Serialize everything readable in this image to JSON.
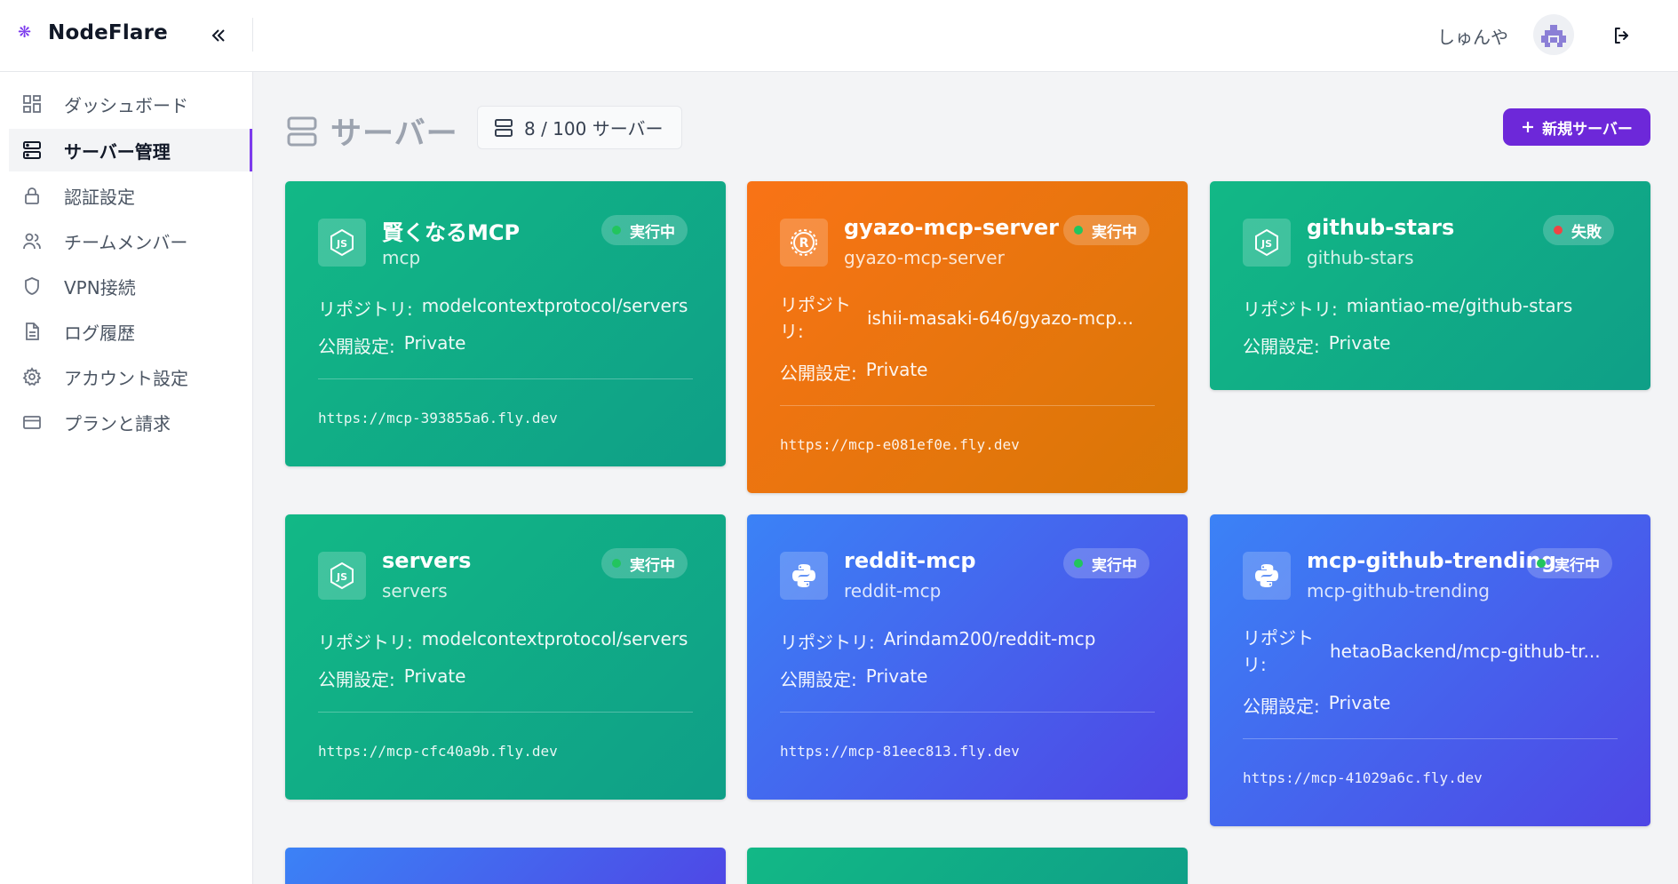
{
  "header": {
    "brand_name": "NodeFlare",
    "user_name": "しゅんや"
  },
  "sidebar": {
    "items": [
      {
        "label": "ダッシュボード",
        "icon": "dashboard-grid-icon"
      },
      {
        "label": "サーバー管理",
        "icon": "server-icon",
        "active": true
      },
      {
        "label": "認証設定",
        "icon": "lock-icon"
      },
      {
        "label": "チームメンバー",
        "icon": "users-icon"
      },
      {
        "label": "VPN接続",
        "icon": "shield-icon"
      },
      {
        "label": "ログ履歴",
        "icon": "document-icon"
      },
      {
        "label": "アカウント設定",
        "icon": "gear-icon"
      },
      {
        "label": "プランと請求",
        "icon": "credit-card-icon"
      }
    ]
  },
  "main": {
    "title": "サーバー",
    "count_label": "8 / 100 サーバー",
    "new_button_label": "新規サーバー"
  },
  "labels": {
    "repository": "リポジトリ:",
    "visibility": "公開設定:"
  },
  "cards": [
    {
      "name": "賢くなるMCP",
      "sub": "mcp",
      "status": "実行中",
      "repo": "modelcontextprotocol/servers",
      "visibility": "Private",
      "url": "https://mcp-393855a6.fly.dev",
      "theme": "green",
      "runtime": "nodejs-icon"
    },
    {
      "name": "gyazo-mcp-server",
      "sub": "gyazo-mcp-server",
      "status": "実行中",
      "repo": "ishii-masaki-646/gyazo-mcp...",
      "visibility": "Private",
      "url": "https://mcp-e081ef0e.fly.dev",
      "theme": "orange",
      "runtime": "rust-icon"
    },
    {
      "name": "github-stars",
      "sub": "github-stars",
      "status": "失敗",
      "repo": "miantiao-me/github-stars",
      "visibility": "Private",
      "url": "",
      "theme": "green",
      "runtime": "nodejs-icon"
    },
    {
      "name": "servers",
      "sub": "servers",
      "status": "実行中",
      "repo": "modelcontextprotocol/servers",
      "visibility": "Private",
      "url": "https://mcp-cfc40a9b.fly.dev",
      "theme": "green",
      "runtime": "nodejs-icon"
    },
    {
      "name": "reddit-mcp",
      "sub": "reddit-mcp",
      "status": "実行中",
      "repo": "Arindam200/reddit-mcp",
      "visibility": "Private",
      "url": "https://mcp-81eec813.fly.dev",
      "theme": "blue",
      "runtime": "python-icon"
    },
    {
      "name": "mcp-github-trending",
      "sub": "mcp-github-trending",
      "status": "実行中",
      "repo": "hetaoBackend/mcp-github-tr...",
      "visibility": "Private",
      "url": "https://mcp-41029a6c.fly.dev",
      "theme": "blue",
      "runtime": "python-icon"
    }
  ],
  "colors": {
    "accent": "#6d28d9",
    "running_dot": "#22c55e",
    "failed_dot": "#ef4444",
    "green_card": "#12b886",
    "orange_card": "#f97316",
    "blue_card": "#3b82f6"
  }
}
